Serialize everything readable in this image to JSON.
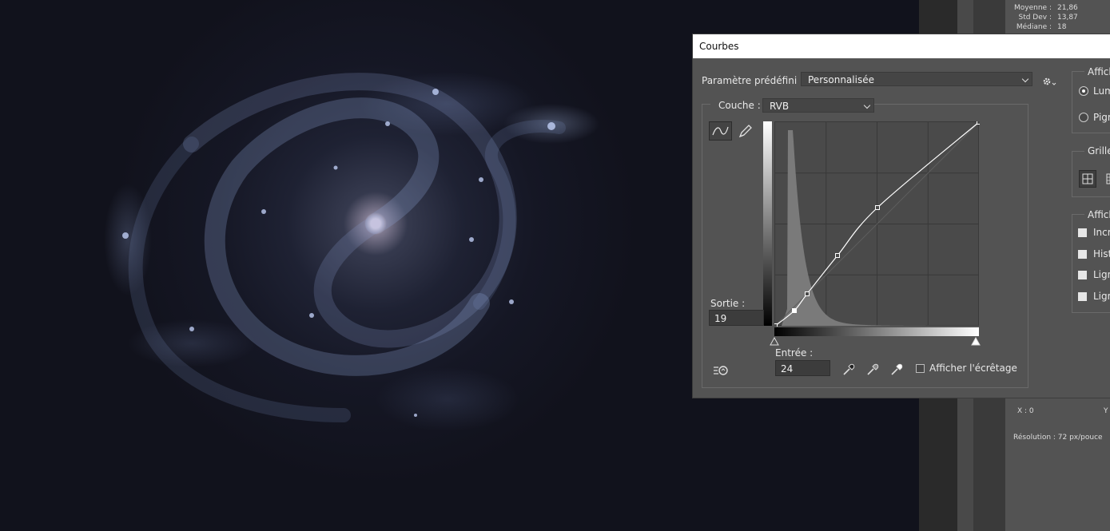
{
  "stats": [
    {
      "label": "Moyenne :",
      "value": "21,86"
    },
    {
      "label": "Std Dev :",
      "value": "13,87"
    },
    {
      "label": "Médiane :",
      "value": "18"
    }
  ],
  "info": {
    "x_label": "X : 0",
    "y_label": "Y",
    "resolution": "Résolution : 72 px/pouce"
  },
  "dialog": {
    "title": "Courbes",
    "preset_label": "Paramètre prédéfini :",
    "preset_value": "Personnalisée",
    "channel_label": "Couche :",
    "channel_value": "RVB",
    "output_label": "Sortie :",
    "output_value": "19",
    "input_label": "Entrée :",
    "input_value": "24",
    "clipping_label": "Afficher l'écrêtage",
    "clipping_checked": false,
    "right": {
      "display_title": "Affich",
      "radio_light": "Lum",
      "radio_pigment": "Pigm",
      "grid_title": "Grille",
      "show_title": "Affich",
      "checks": [
        "Incr",
        "Hist",
        "Lign",
        "Lign"
      ]
    }
  },
  "curve": {
    "points": [
      [
        0,
        0
      ],
      [
        24,
        19
      ],
      [
        40,
        40
      ],
      [
        78,
        88
      ],
      [
        128,
        148
      ],
      [
        255,
        255
      ]
    ],
    "histogram_peak_input": 22
  },
  "colors": {
    "dialog_bg": "#535353",
    "graph_bg": "#4a4a4a",
    "curve": "#ffffff"
  }
}
